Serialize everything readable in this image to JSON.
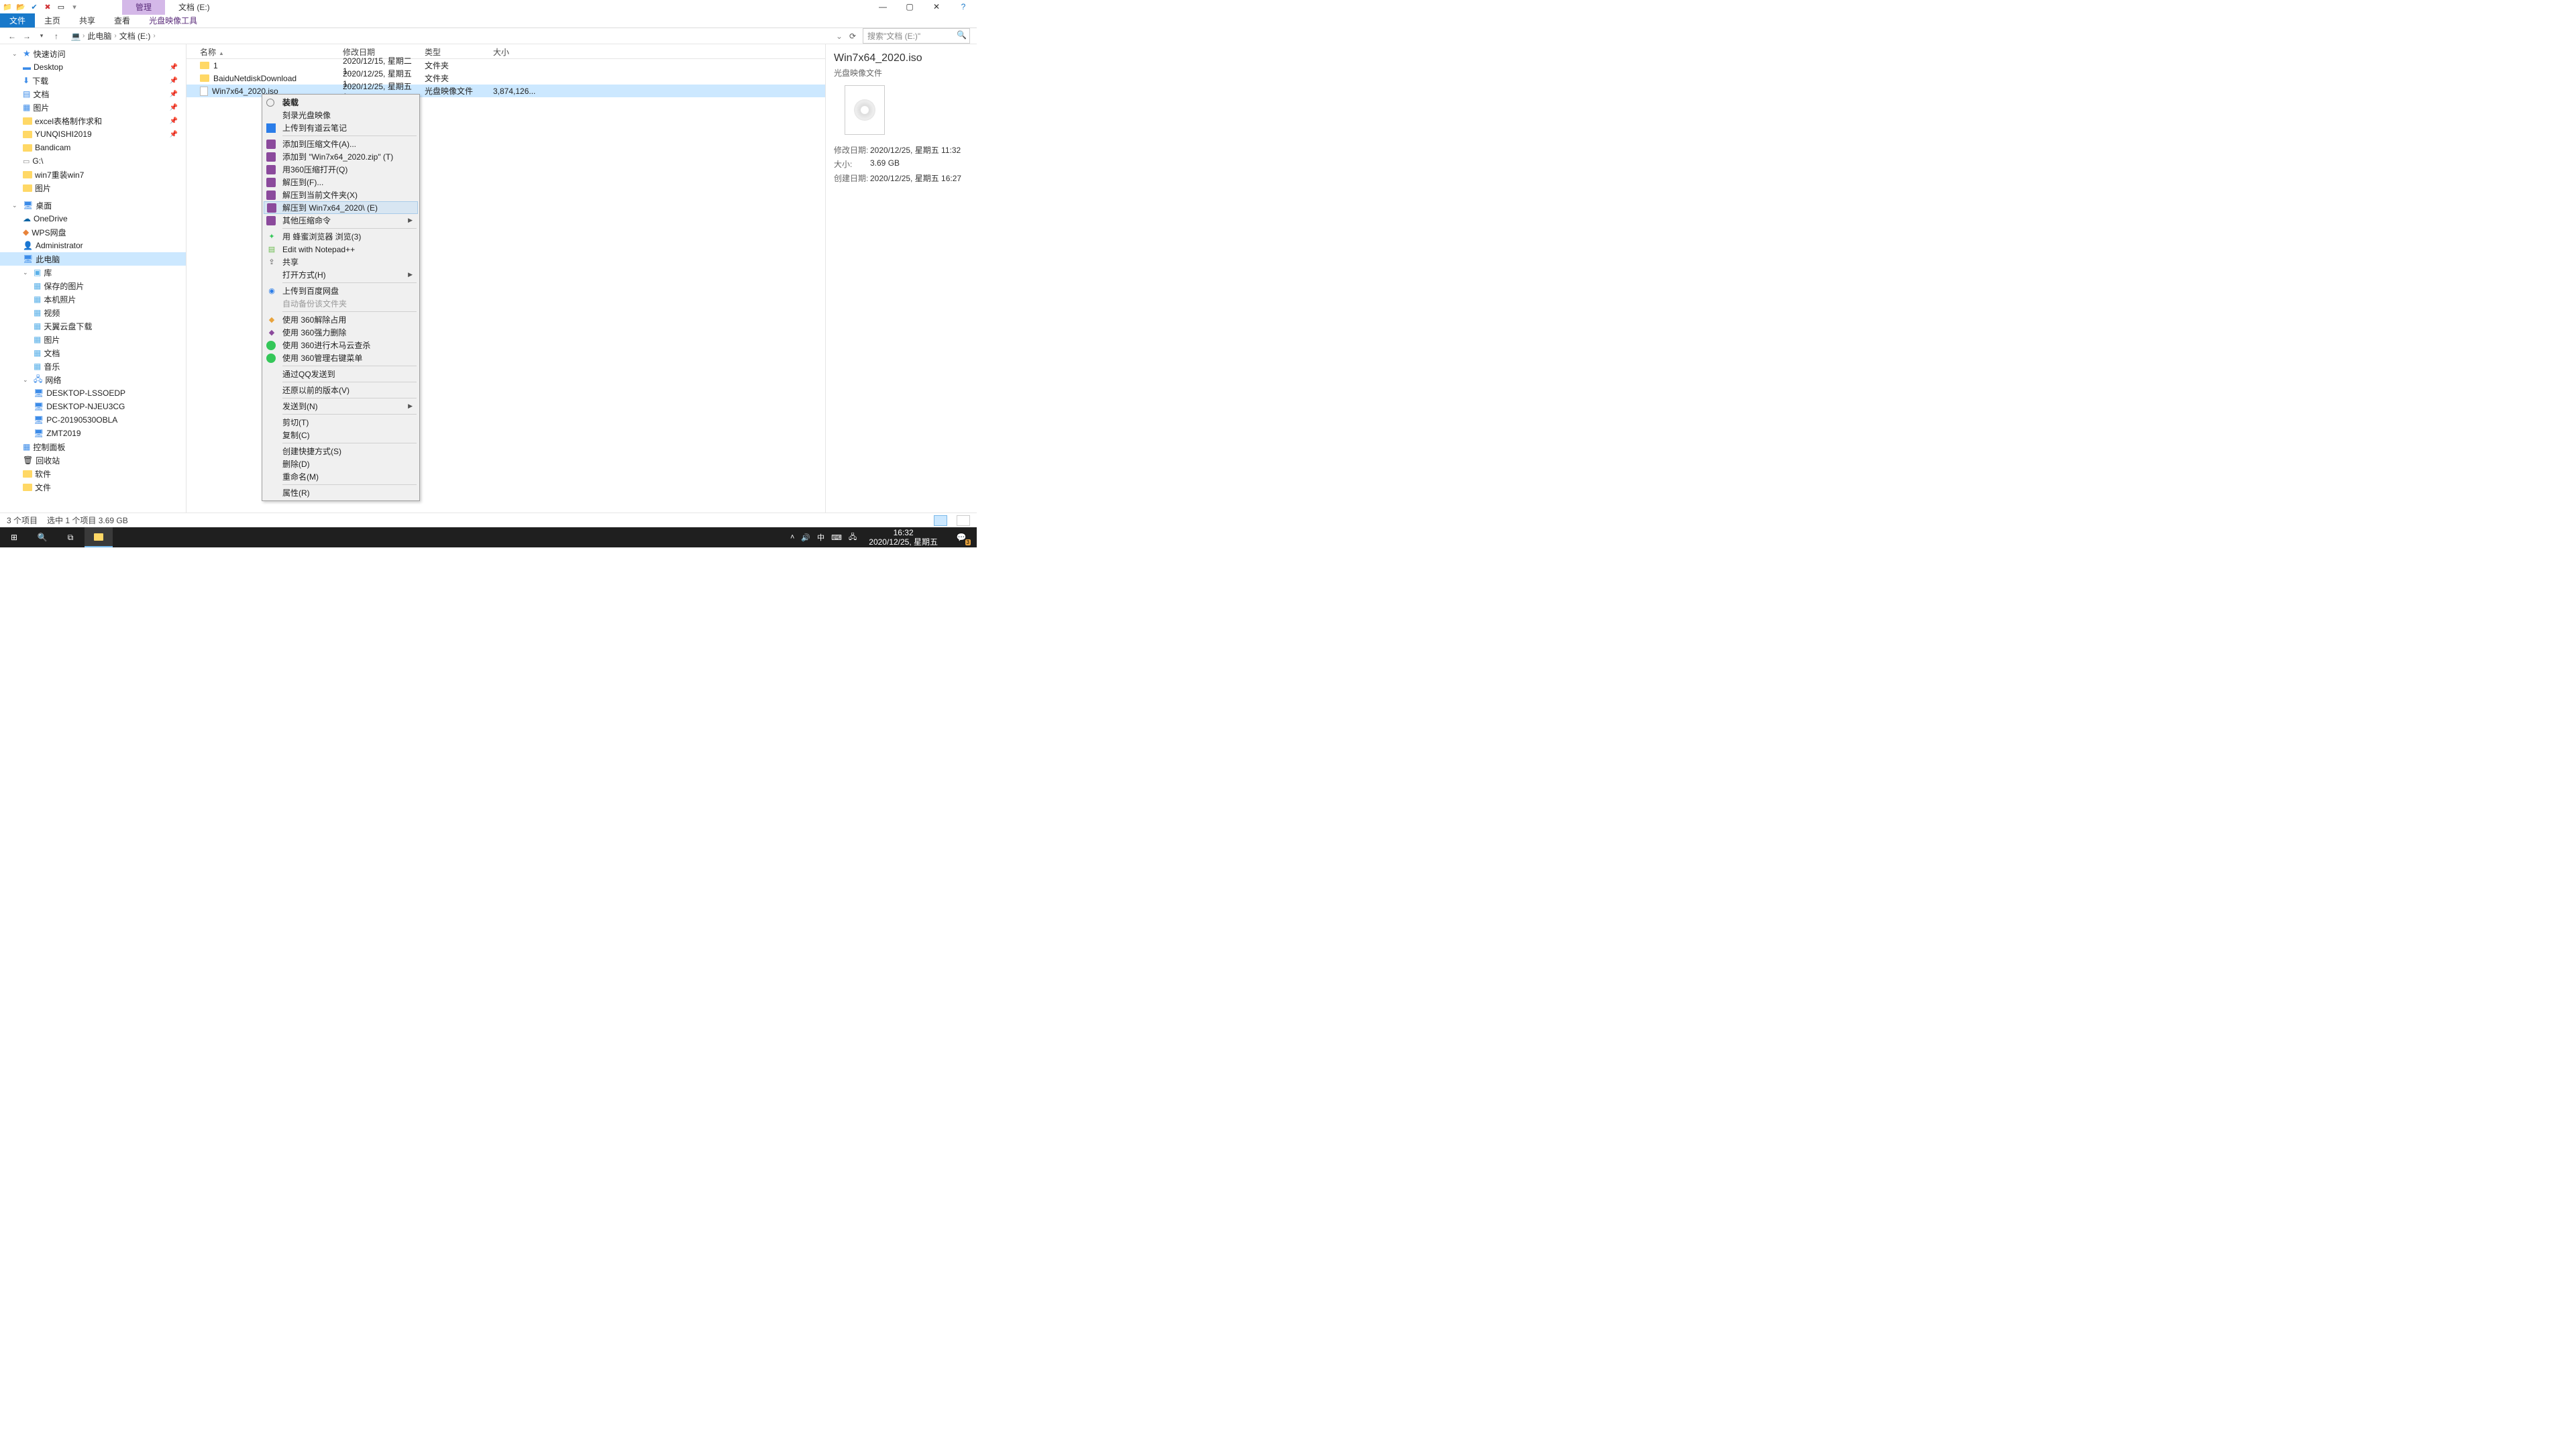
{
  "titlebar": {
    "manage_tab": "管理",
    "location_tab": "文档 (E:)"
  },
  "ribbon": {
    "file": "文件",
    "home": "主页",
    "share": "共享",
    "view": "查看",
    "disc_tools": "光盘映像工具"
  },
  "breadcrumb": {
    "root": "此电脑",
    "drive": "文档 (E:)"
  },
  "search": {
    "placeholder": "搜索\"文档 (E:)\""
  },
  "sidebar": {
    "quick": "快速访问",
    "desktop": "Desktop",
    "downloads": "下载",
    "documents": "文档",
    "pictures": "图片",
    "excel": "excel表格制作求和",
    "yunqishi": "YUNQISHI2019",
    "bandicam": "Bandicam",
    "gdrive": "G:\\",
    "win7reinstall": "win7重装win7",
    "pictures2": "图片",
    "desktop_cn": "桌面",
    "onedrive": "OneDrive",
    "wps": "WPS网盘",
    "admin": "Administrator",
    "thispc": "此电脑",
    "library": "库",
    "saved_pics": "保存的图片",
    "camera_roll": "本机照片",
    "videos": "视频",
    "tianyi": "天翼云盘下载",
    "lib_pics": "图片",
    "lib_docs": "文档",
    "lib_music": "音乐",
    "network": "网络",
    "pc1": "DESKTOP-LSSOEDP",
    "pc2": "DESKTOP-NJEU3CG",
    "pc3": "PC-20190530OBLA",
    "pc4": "ZMT2019",
    "control": "控制面板",
    "recycle": "回收站",
    "software": "软件",
    "files": "文件"
  },
  "columns": {
    "name": "名称",
    "date": "修改日期",
    "type": "类型",
    "size": "大小"
  },
  "rows": [
    {
      "name": "1",
      "date": "2020/12/15, 星期二 1...",
      "type": "文件夹",
      "size": "",
      "kind": "folder"
    },
    {
      "name": "BaiduNetdiskDownload",
      "date": "2020/12/25, 星期五 1...",
      "type": "文件夹",
      "size": "",
      "kind": "folder"
    },
    {
      "name": "Win7x64_2020.iso",
      "date": "2020/12/25, 星期五 1...",
      "type": "光盘映像文件",
      "size": "3,874,126...",
      "kind": "iso"
    }
  ],
  "context": {
    "mount": "装载",
    "burn": "刻录光盘映像",
    "ynote": "上传到有道云笔记",
    "add_archive": "添加到压缩文件(A)...",
    "add_zip": "添加到 \"Win7x64_2020.zip\" (T)",
    "open_360": "用360压缩打开(Q)",
    "extract_to": "解压到(F)...",
    "extract_here": "解压到当前文件夹(X)",
    "extract_named": "解压到 Win7x64_2020\\ (E)",
    "other_compress": "其他压缩命令",
    "fengmi": "用 蜂蜜浏览器 浏览(3)",
    "notepad": "Edit with Notepad++",
    "share": "共享",
    "open_with": "打开方式(H)",
    "baidu_upload": "上传到百度网盘",
    "auto_backup": "自动备份该文件夹",
    "unlock_360": "使用 360解除占用",
    "force_del_360": "使用 360强力删除",
    "trojan_360": "使用 360进行木马云查杀",
    "manage_360": "使用 360管理右键菜单",
    "qq_send": "通过QQ发送到",
    "restore_prev": "还原以前的版本(V)",
    "send_to": "发送到(N)",
    "cut": "剪切(T)",
    "copy": "复制(C)",
    "shortcut": "创建快捷方式(S)",
    "delete": "删除(D)",
    "rename": "重命名(M)",
    "properties": "属性(R)"
  },
  "details": {
    "title": "Win7x64_2020.iso",
    "subtype": "光盘映像文件",
    "mod_label": "修改日期:",
    "mod_val": "2020/12/25, 星期五 11:32",
    "size_label": "大小:",
    "size_val": "3.69 GB",
    "created_label": "创建日期:",
    "created_val": "2020/12/25, 星期五 16:27"
  },
  "status": {
    "count": "3 个项目",
    "selected": "选中 1 个项目  3.69 GB"
  },
  "taskbar": {
    "ime": "中",
    "time": "16:32",
    "date": "2020/12/25, 星期五",
    "badge": "3"
  }
}
